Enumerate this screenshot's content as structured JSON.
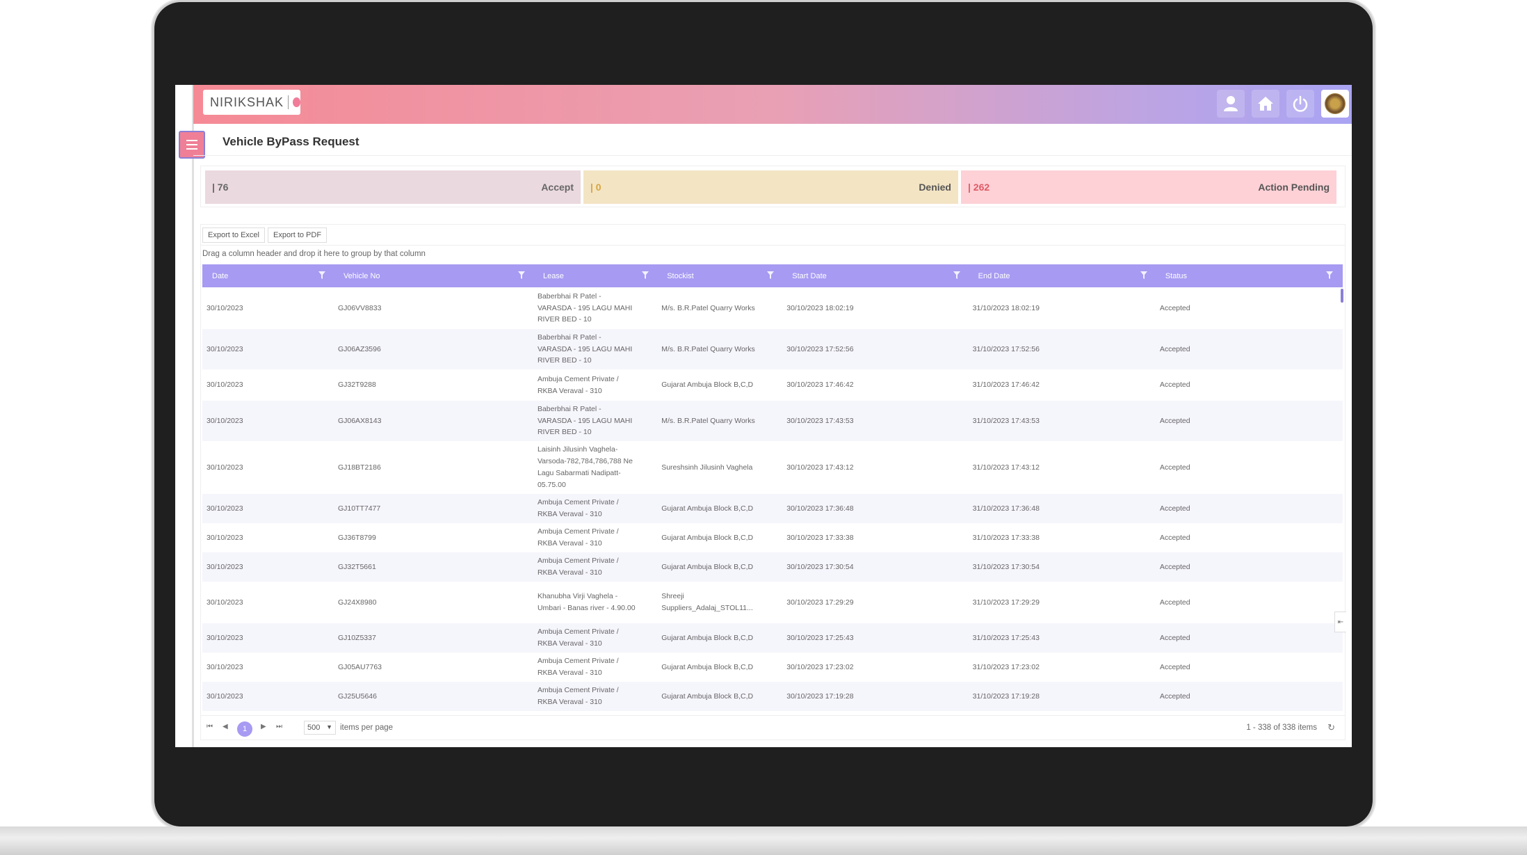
{
  "app": {
    "brand": "NIRIKSHAK"
  },
  "page": {
    "title": "Vehicle ByPass Request"
  },
  "stats": [
    {
      "num": "| 76",
      "label": "Accept"
    },
    {
      "num": "| 0",
      "label": "Denied"
    },
    {
      "num": "| 262",
      "label": "Action Pending"
    }
  ],
  "toolbar": {
    "excel": "Export to Excel",
    "pdf": "Export to PDF"
  },
  "group_hint": "Drag a column header and drop it here to group by that column",
  "columns": [
    "Date",
    "Vehicle No",
    "Lease",
    "Stockist",
    "Start Date",
    "End Date",
    "Status"
  ],
  "rows": [
    {
      "date": "30/10/2023",
      "vehicle": "GJ06VV8833",
      "lease": "Baberbhai R Patel - VARASDA - 195 LAGU MAHI RIVER BED - 10",
      "stockist": "M/s. B.R.Patel Quarry Works",
      "start": "30/10/2023 18:02:19",
      "end": "31/10/2023 18:02:19",
      "status": "Accepted"
    },
    {
      "date": "30/10/2023",
      "vehicle": "GJ06AZ3596",
      "lease": "Baberbhai R Patel - VARASDA - 195 LAGU MAHI RIVER BED - 10",
      "stockist": "M/s. B.R.Patel Quarry Works",
      "start": "30/10/2023 17:52:56",
      "end": "31/10/2023 17:52:56",
      "status": "Accepted"
    },
    {
      "date": "30/10/2023",
      "vehicle": "GJ32T9288",
      "lease": "Ambuja Cement Private / RKBA Veraval - 310",
      "stockist": "Gujarat Ambuja Block B,C,D",
      "start": "30/10/2023 17:46:42",
      "end": "31/10/2023 17:46:42",
      "status": "Accepted"
    },
    {
      "date": "30/10/2023",
      "vehicle": "GJ06AX8143",
      "lease": "Baberbhai R Patel - VARASDA - 195 LAGU MAHI RIVER BED - 10",
      "stockist": "M/s. B.R.Patel Quarry Works",
      "start": "30/10/2023 17:43:53",
      "end": "31/10/2023 17:43:53",
      "status": "Accepted"
    },
    {
      "date": "30/10/2023",
      "vehicle": "GJ18BT2186",
      "lease": "Laisinh Jilusinh Vaghela-Varsoda-782,784,786,788 Ne Lagu Sabarmati Nadipatt-05.75.00",
      "stockist": "Sureshsinh Jilusinh Vaghela",
      "start": "30/10/2023 17:43:12",
      "end": "31/10/2023 17:43:12",
      "status": "Accepted"
    },
    {
      "date": "30/10/2023",
      "vehicle": "GJ10TT7477",
      "lease": "Ambuja Cement Private / RKBA Veraval - 310",
      "stockist": "Gujarat Ambuja Block B,C,D",
      "start": "30/10/2023 17:36:48",
      "end": "31/10/2023 17:36:48",
      "status": "Accepted"
    },
    {
      "date": "30/10/2023",
      "vehicle": "GJ36T8799",
      "lease": "Ambuja Cement Private / RKBA Veraval - 310",
      "stockist": "Gujarat Ambuja Block B,C,D",
      "start": "30/10/2023 17:33:38",
      "end": "31/10/2023 17:33:38",
      "status": "Accepted"
    },
    {
      "date": "30/10/2023",
      "vehicle": "GJ32T5661",
      "lease": "Ambuja Cement Private / RKBA Veraval - 310",
      "stockist": "Gujarat Ambuja Block B,C,D",
      "start": "30/10/2023 17:30:54",
      "end": "31/10/2023 17:30:54",
      "status": "Accepted"
    },
    {
      "date": "30/10/2023",
      "vehicle": "GJ24X8980",
      "lease": "Khanubha Virji Vaghela - Umbari - Banas river - 4.90.00",
      "stockist": "Shreeji Suppliers_Adalaj_STOL11...",
      "start": "30/10/2023 17:29:29",
      "end": "31/10/2023 17:29:29",
      "status": "Accepted"
    },
    {
      "date": "30/10/2023",
      "vehicle": "GJ10Z5337",
      "lease": "Ambuja Cement Private / RKBA Veraval - 310",
      "stockist": "Gujarat Ambuja Block B,C,D",
      "start": "30/10/2023 17:25:43",
      "end": "31/10/2023 17:25:43",
      "status": "Accepted"
    },
    {
      "date": "30/10/2023",
      "vehicle": "GJ05AU7763",
      "lease": "Ambuja Cement Private / RKBA Veraval - 310",
      "stockist": "Gujarat Ambuja Block B,C,D",
      "start": "30/10/2023 17:23:02",
      "end": "31/10/2023 17:23:02",
      "status": "Accepted"
    },
    {
      "date": "30/10/2023",
      "vehicle": "GJ25U5646",
      "lease": "Ambuja Cement Private / RKBA Veraval - 310",
      "stockist": "Gujarat Ambuja Block B,C,D",
      "start": "30/10/2023 17:19:28",
      "end": "31/10/2023 17:19:28",
      "status": "Accepted"
    }
  ],
  "pager": {
    "current": "1",
    "page_size": "500",
    "items_label": "items per page",
    "info": "1 - 338 of 338 items"
  },
  "colors": {
    "header": "#a69af2",
    "accent": "#ef7f96"
  }
}
